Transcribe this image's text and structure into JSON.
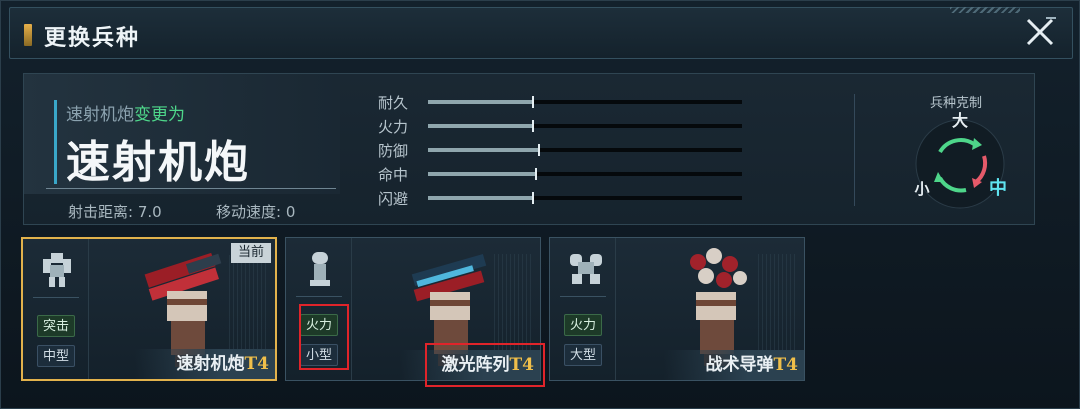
{
  "window": {
    "title": "更换兵种"
  },
  "info": {
    "from_unit": "速射机炮",
    "change_verb": "变更为",
    "unit_name": "速射机炮",
    "range_label": "射击距离: 7.0",
    "speed_label": "移动速度: 0",
    "attributes": [
      {
        "label": "耐久",
        "value": 0.33
      },
      {
        "label": "火力",
        "value": 0.33
      },
      {
        "label": "防御",
        "value": 0.35
      },
      {
        "label": "命中",
        "value": 0.34
      },
      {
        "label": "闪避",
        "value": 0.33
      }
    ]
  },
  "counter": {
    "title": "兵种克制",
    "big": "大",
    "small": "小",
    "mid": "中"
  },
  "cards": [
    {
      "role": "突击",
      "size": "中型",
      "name": "速射机炮",
      "tier": "T4",
      "badge": "当前",
      "selected": true
    },
    {
      "role": "火力",
      "size": "小型",
      "name": "激光阵列",
      "tier": "T4",
      "badge": "",
      "selected": false
    },
    {
      "role": "火力",
      "size": "大型",
      "name": "战术导弹",
      "tier": "T4",
      "badge": "",
      "selected": false
    }
  ],
  "colors": {
    "accent_gold": "#e2b24c",
    "highlight_red": "#e0242a",
    "cyan": "#3aa7c8",
    "green": "#4ed68a"
  }
}
